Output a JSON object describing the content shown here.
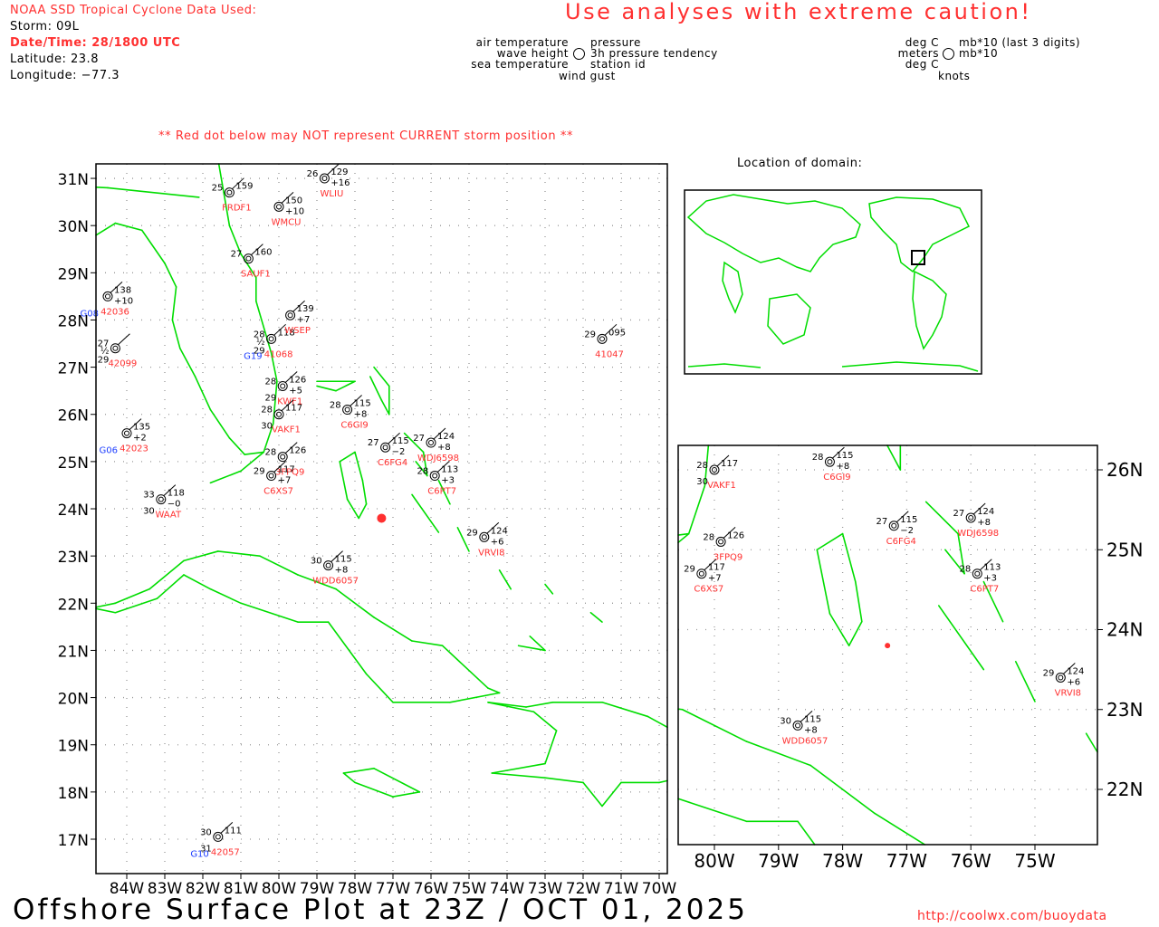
{
  "header": {
    "source_label": "NOAA SSD Tropical Cyclone Data Used:",
    "storm": "Storm: 09L",
    "datetime": "Date/Time: 28/1800 UTC",
    "latitude": "Latitude: 23.8",
    "longitude": "Longitude: −77.3",
    "caution": "Use analyses with extreme caution!",
    "red_dot_note": "** Red dot below may NOT represent CURRENT storm position **"
  },
  "legend_left": {
    "air_temperature": "air temperature",
    "wave_height": "wave height",
    "sea_temperature": "sea temperature",
    "pressure": "pressure",
    "tendency": "3h pressure tendency",
    "station_id": "station id",
    "wind_gust": "wind gust"
  },
  "legend_right": {
    "deg_c_1": "deg C",
    "meters": "meters",
    "deg_c_2": "deg C",
    "mb_last3": "mb*10 (last 3 digits)",
    "mb10": "mb*10",
    "knots": "knots"
  },
  "inset_title": "Location of domain:",
  "main_map": {
    "lat_labels": [
      "31N",
      "30N",
      "29N",
      "28N",
      "27N",
      "26N",
      "25N",
      "24N",
      "23N",
      "22N",
      "21N",
      "20N",
      "19N",
      "18N",
      "17N"
    ],
    "lon_labels": [
      "84W",
      "83W",
      "82W",
      "81W",
      "80W",
      "79W",
      "78W",
      "77W",
      "76W",
      "75W",
      "74W",
      "73W",
      "72W",
      "71W",
      "70W"
    ]
  },
  "zoom_map": {
    "lat_labels": [
      "26N",
      "25N",
      "24N",
      "23N",
      "22N"
    ],
    "lon_labels": [
      "80W",
      "79W",
      "78W",
      "77W",
      "76W",
      "75W"
    ]
  },
  "storm_position": {
    "lat": 23.8,
    "lon": -77.3,
    "color": "#ff3030"
  },
  "stations": [
    {
      "id": "WLIU",
      "lat": 31.0,
      "lon": -78.8,
      "t": "26",
      "p": "129",
      "d": "+16"
    },
    {
      "id": "WMCU",
      "lat": 30.4,
      "lon": -80.0,
      "t": "",
      "p": "150",
      "d": "+10"
    },
    {
      "id": "FRDF1",
      "lat": 30.7,
      "lon": -81.3,
      "t": "25",
      "p": "159",
      "d": ""
    },
    {
      "id": "SAUF1",
      "lat": 29.3,
      "lon": -80.8,
      "t": "27",
      "p": "160",
      "d": ""
    },
    {
      "id": "41047",
      "lat": 27.6,
      "lon": -71.5,
      "t": "29",
      "p": "095",
      "d": ""
    },
    {
      "id": "42036",
      "lat": 28.5,
      "lon": -84.5,
      "t": "",
      "p": "138",
      "d": "+10",
      "sst": "G08"
    },
    {
      "id": "42099",
      "lat": 27.4,
      "lon": -84.3,
      "t": "27",
      "p": "",
      "d": "",
      "w": "½",
      "s": "29"
    },
    {
      "id": "42023",
      "lat": 25.6,
      "lon": -84.0,
      "t": "",
      "p": "135",
      "d": "+2",
      "sst": "G06"
    },
    {
      "id": "WAAT",
      "lat": 24.2,
      "lon": -83.1,
      "t": "33",
      "p": "118",
      "d": "−0",
      "s": "30"
    },
    {
      "id": "42057",
      "lat": 17.05,
      "lon": -81.6,
      "t": "30",
      "p": "111",
      "d": "",
      "s": "31",
      "sst": "G10"
    },
    {
      "id": "41068",
      "lat": 27.6,
      "lon": -80.2,
      "t": "28",
      "p": "118",
      "d": "",
      "w": "½",
      "s": "29",
      "sst": "G19"
    },
    {
      "id": "WSEP",
      "lat": 28.1,
      "lon": -79.7,
      "t": "",
      "p": "139",
      "d": "+7"
    },
    {
      "id": "KWF1",
      "lat": 26.6,
      "lon": -79.9,
      "t": "28",
      "p": "126",
      "d": "+5",
      "s": "29"
    },
    {
      "id": "VAKF1",
      "lat": 26.0,
      "lon": -80.0,
      "t": "28",
      "p": "117",
      "d": "",
      "s": "30"
    },
    {
      "id": "3FPQ9",
      "lat": 25.1,
      "lon": -79.9,
      "t": "28",
      "p": "126",
      "d": ""
    },
    {
      "id": "C6XS7",
      "lat": 24.7,
      "lon": -80.2,
      "t": "29",
      "p": "117",
      "d": "+7"
    },
    {
      "id": "C6GI9",
      "lat": 26.1,
      "lon": -78.2,
      "t": "28",
      "p": "115",
      "d": "+8"
    },
    {
      "id": "C6FG4",
      "lat": 25.3,
      "lon": -77.2,
      "t": "27",
      "p": "115",
      "d": "−2"
    },
    {
      "id": "WDJ6598",
      "lat": 25.4,
      "lon": -76.0,
      "t": "27",
      "p": "124",
      "d": "+8"
    },
    {
      "id": "C6PT7",
      "lat": 24.7,
      "lon": -75.9,
      "t": "28",
      "p": "113",
      "d": "+3"
    },
    {
      "id": "VRVI8",
      "lat": 23.4,
      "lon": -74.6,
      "t": "29",
      "p": "124",
      "d": "+6"
    },
    {
      "id": "WDD6057",
      "lat": 22.8,
      "lon": -78.7,
      "t": "30",
      "p": "115",
      "d": "+8"
    }
  ],
  "footer": {
    "title": "Offshore Surface Plot at 23Z / OCT 01, 2025",
    "url": "http://coolwx.com/buoydata"
  },
  "colors": {
    "land": "#00dd00",
    "text_red": "#ff3030",
    "sst_blue": "#2040ff"
  }
}
